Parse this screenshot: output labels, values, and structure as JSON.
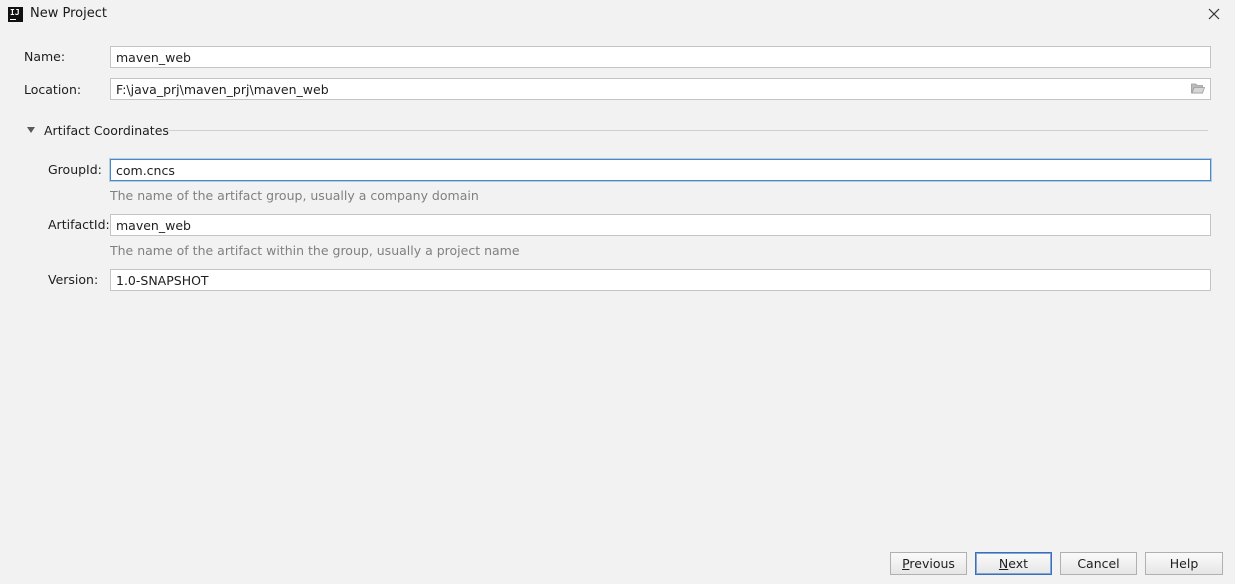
{
  "window": {
    "title": "New Project",
    "app_icon_text": "IJ"
  },
  "form": {
    "name": {
      "label": "Name:",
      "value": "maven_web"
    },
    "location": {
      "label": "Location:",
      "value": "F:\\java_prj\\maven_prj\\maven_web"
    }
  },
  "artifact_section": {
    "title": "Artifact Coordinates",
    "expanded": true,
    "group_id": {
      "label": "GroupId:",
      "value": "com.cncs",
      "hint": "The name of the artifact group, usually a company domain"
    },
    "artifact_id": {
      "label": "ArtifactId:",
      "value": "maven_web",
      "hint": "The name of the artifact within the group, usually a project name"
    },
    "version": {
      "label": "Version:",
      "value": "1.0-SNAPSHOT"
    }
  },
  "buttons": {
    "previous": "Previous",
    "next": "Next",
    "cancel": "Cancel",
    "help": "Help"
  },
  "colors": {
    "background": "#f2f2f2",
    "focus_border": "#4a88c7",
    "hint_text": "#808080"
  },
  "icons": {
    "app": "intellij-idea-icon",
    "close": "close-icon",
    "folder": "folder-icon",
    "collapse": "triangle-down-icon"
  }
}
